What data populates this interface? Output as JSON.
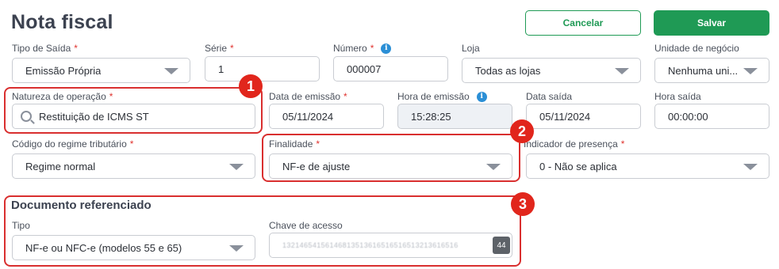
{
  "header": {
    "title": "Nota fiscal",
    "cancel_label": "Cancelar",
    "save_label": "Salvar"
  },
  "row1": {
    "tipo_saida": {
      "label": "Tipo de Saída",
      "required": "*",
      "value": "Emissão Própria"
    },
    "serie": {
      "label": "Série",
      "required": "*",
      "value": "1"
    },
    "numero": {
      "label": "Número",
      "required": "*",
      "info": "i",
      "value": "000007"
    },
    "loja": {
      "label": "Loja",
      "value": "Todas as lojas"
    },
    "unidade_negocio": {
      "label": "Unidade de negócio",
      "value": "Nenhuma uni..."
    }
  },
  "row2": {
    "natureza_operacao": {
      "label": "Natureza de operação",
      "required": "*",
      "value": "Restituição de ICMS ST"
    },
    "data_emissao": {
      "label": "Data de emissão",
      "required": "*",
      "value": "05/11/2024"
    },
    "hora_emissao": {
      "label": "Hora de emissão",
      "info": "i",
      "value": "15:28:25"
    },
    "data_saida": {
      "label": "Data saída",
      "value": "05/11/2024"
    },
    "hora_saida": {
      "label": "Hora saída",
      "value": "00:00:00"
    }
  },
  "row3": {
    "codigo_regime": {
      "label": "Código do regime tributário",
      "required": "*",
      "value": "Regime normal"
    },
    "finalidade": {
      "label": "Finalidade",
      "required": "*",
      "value": "NF-e de ajuste"
    },
    "indicador_presenca": {
      "label": "Indicador de presença",
      "required": "*",
      "value": "0 - Não se aplica"
    }
  },
  "documento_referenciado": {
    "title": "Documento referenciado",
    "tipo": {
      "label": "Tipo",
      "value": "NF-e ou NFC-e (modelos 55 e 65)"
    },
    "chave_acesso": {
      "label": "Chave de acesso",
      "value": "13214654156146813513616516516513213616516",
      "count": "44"
    }
  },
  "markers": [
    "1",
    "2",
    "3"
  ],
  "colors": {
    "primary_green": "#1f9a55",
    "required_red": "#e0332f",
    "highlight_red": "#d92f2f",
    "info_blue": "#2b8fd6"
  }
}
